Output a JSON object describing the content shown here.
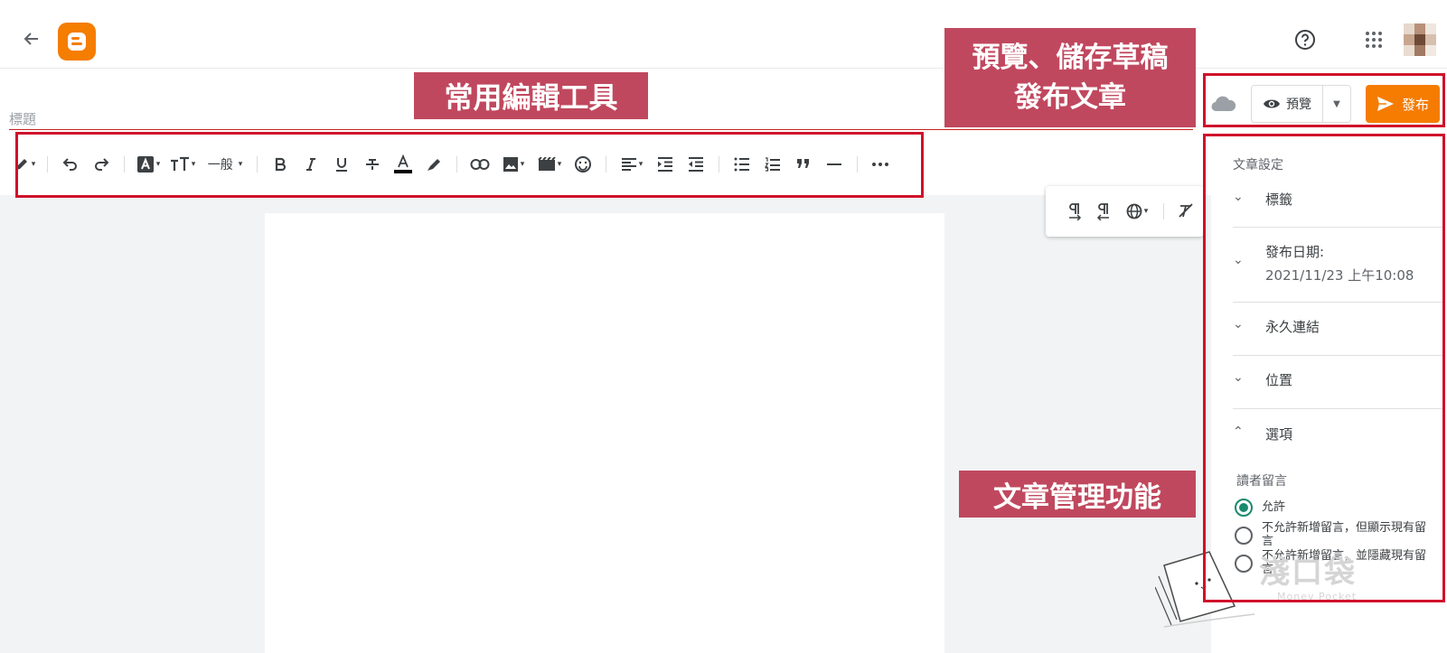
{
  "header": {
    "back_icon": "arrow-left-icon",
    "logo_icon": "blogger-logo-icon",
    "help_icon": "help-circle-icon",
    "apps_icon": "apps-grid-icon",
    "brand_color": "#f57d00"
  },
  "editor": {
    "title_placeholder": "標題",
    "toolbar": {
      "paragraph_style": "一般"
    }
  },
  "actions": {
    "save_icon": "cloud-icon",
    "preview_label": "預覽",
    "publish_label": "發布",
    "publish_color": "#f57c00"
  },
  "sidebar": {
    "heading": "文章設定",
    "items": [
      {
        "label": "標籤",
        "expanded": false
      },
      {
        "label": "發布日期:",
        "value": "2021/11/23 上午10:08",
        "expanded": false
      },
      {
        "label": "永久連結",
        "expanded": false
      },
      {
        "label": "位置",
        "expanded": false
      },
      {
        "label": "選項",
        "expanded": true
      }
    ],
    "comments": {
      "label": "讀者留言",
      "options": [
        {
          "label": "允許",
          "selected": true
        },
        {
          "label": "不允許新增留言，但顯示現有留言",
          "selected": false
        },
        {
          "label": "不允許新增留言，並隱藏現有留言",
          "selected": false
        }
      ]
    }
  },
  "annotations": {
    "toolbar_label": "常用編輯工具",
    "actions_line1": "預覽、儲存草稿",
    "actions_line2": "發布文章",
    "panel_label": "文章管理功能",
    "box_color": "#d0112b",
    "label_color": "#c0485e"
  },
  "watermark": {
    "title": "淺口袋",
    "subtitle": "Money Pocket"
  }
}
